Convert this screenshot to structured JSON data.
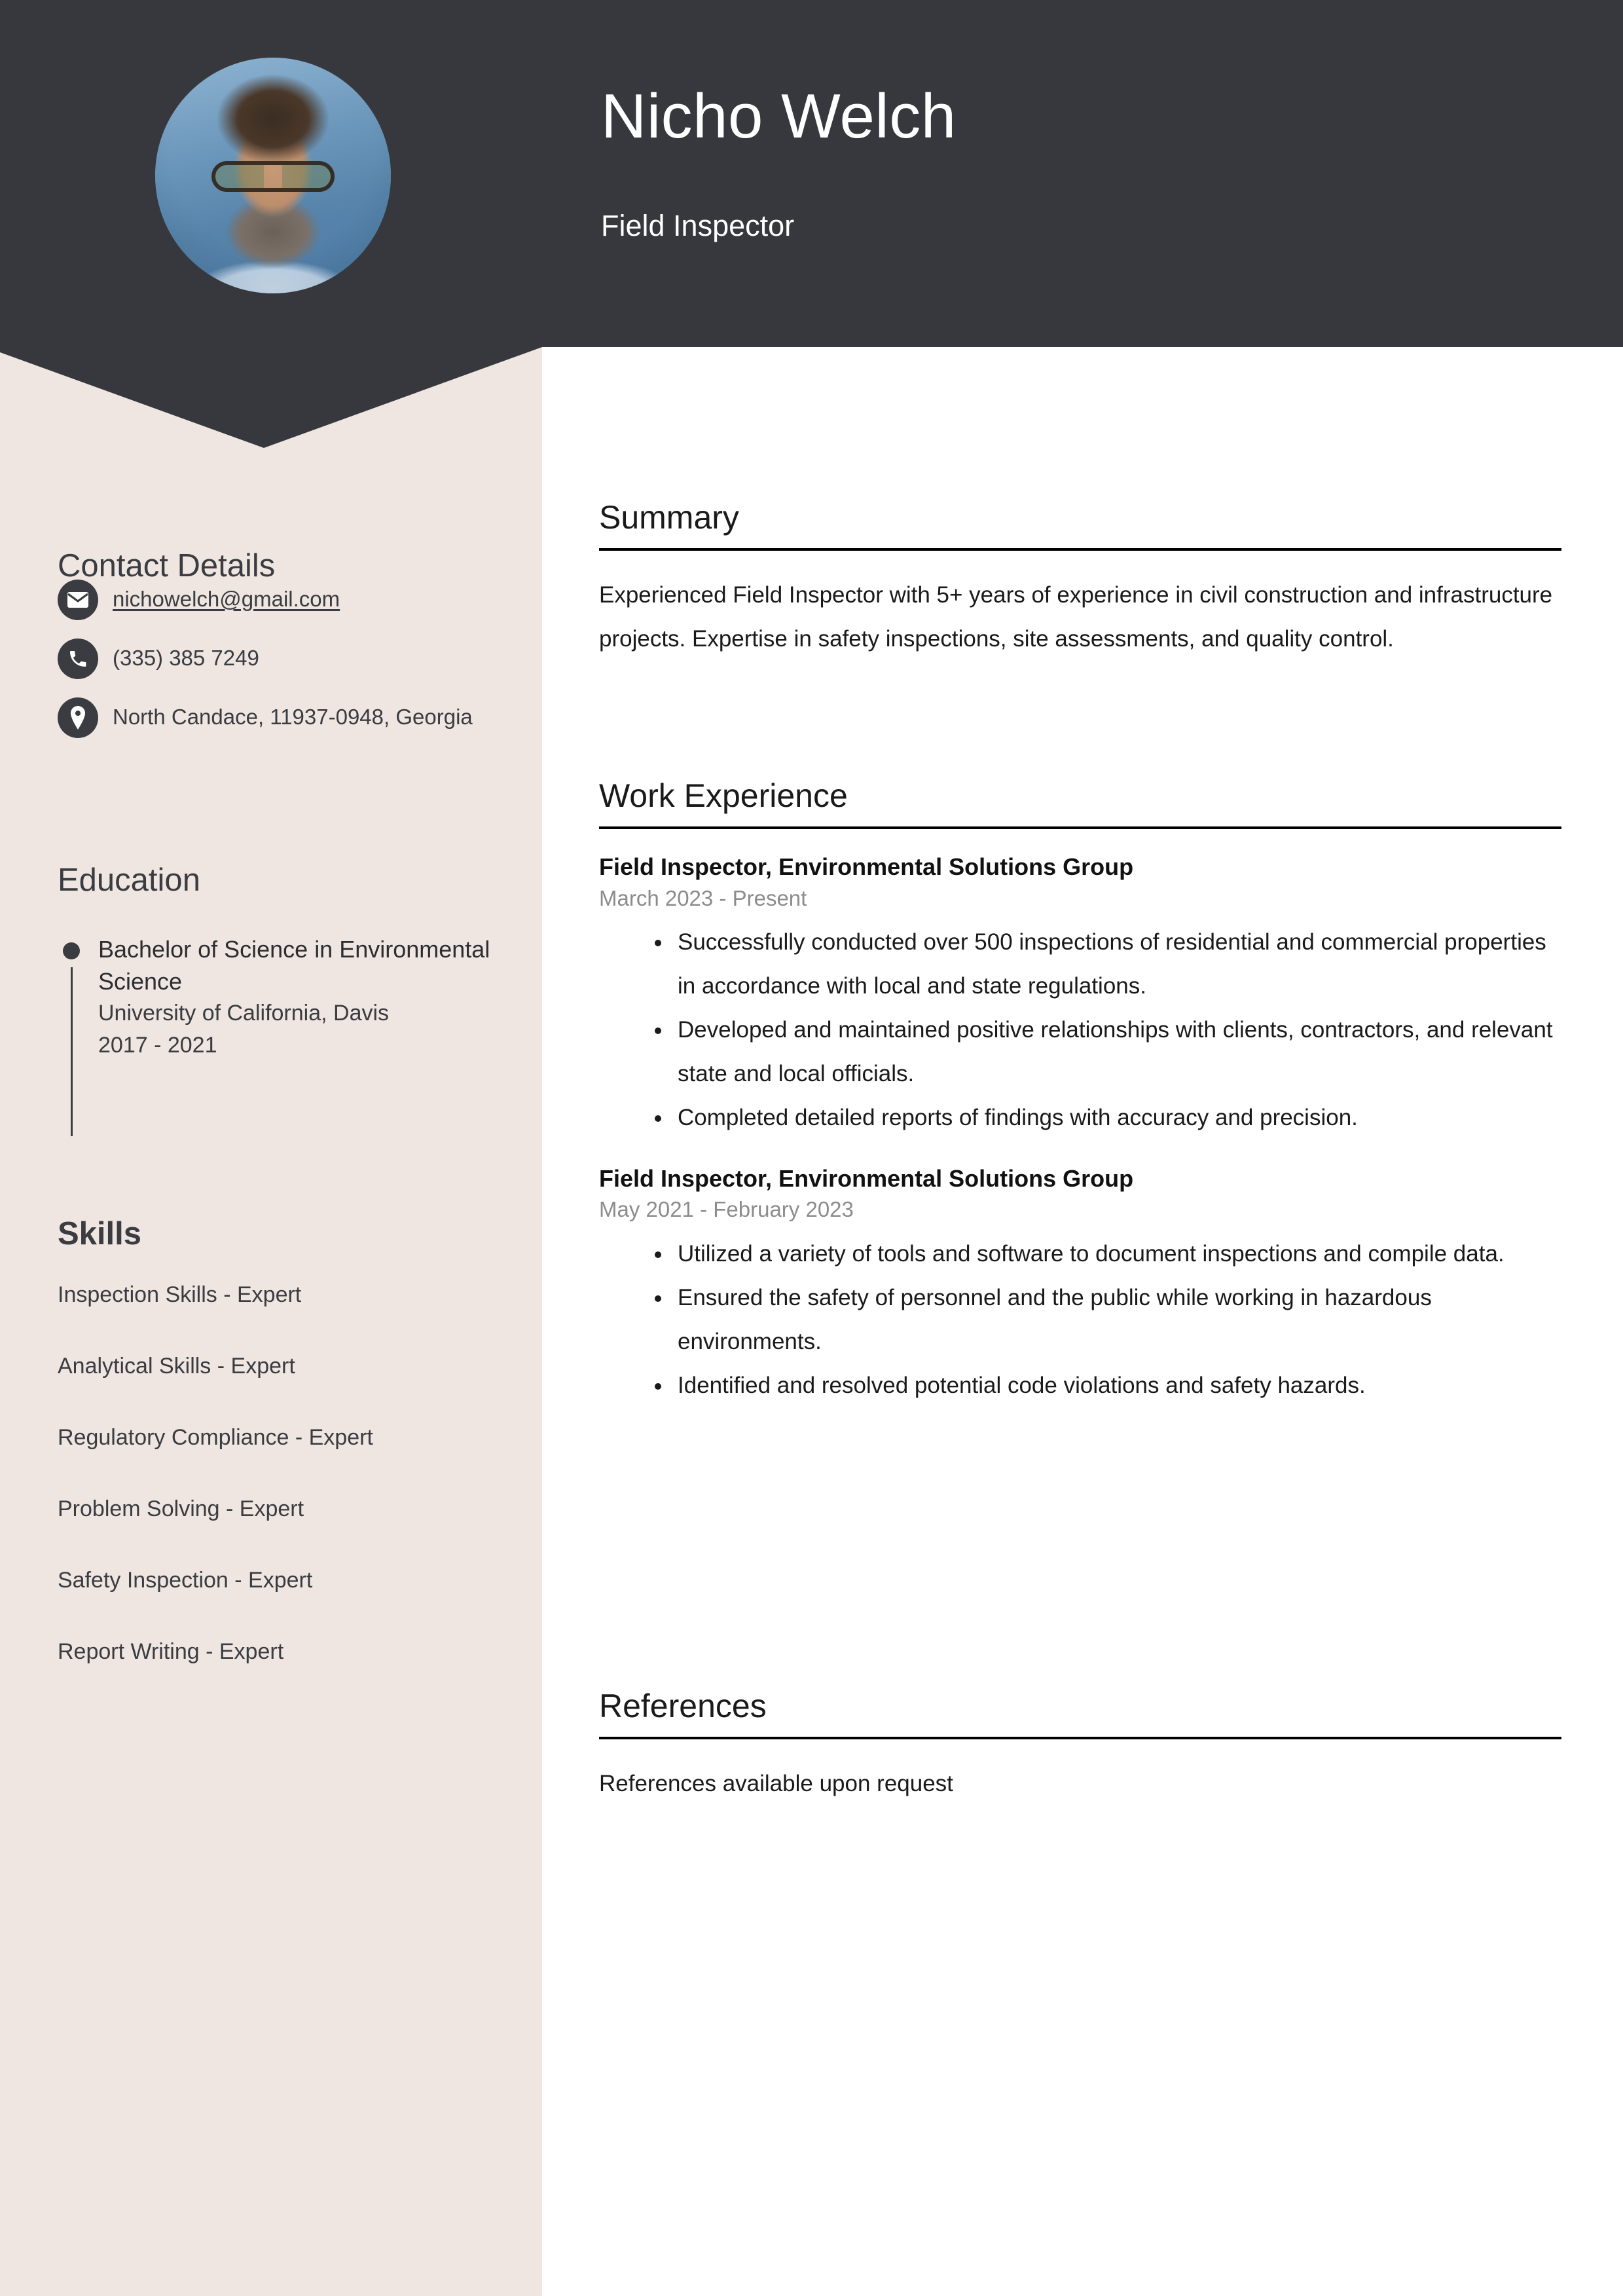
{
  "header": {
    "name": "Nicho Welch",
    "job_title": "Field Inspector",
    "background_color": "#36383D",
    "avatar_alt": "portrait-photo"
  },
  "sidebar": {
    "background_color": "#EFE6E1",
    "contact": {
      "heading": "Contact Details",
      "items": [
        {
          "icon": "envelope-icon",
          "value": "nichowelch@gmail.com",
          "type": "email"
        },
        {
          "icon": "phone-icon",
          "value": "(335) 385 7249",
          "type": "phone"
        },
        {
          "icon": "location-pin-icon",
          "value": "North Candace, 11937-0948, Georgia",
          "type": "address"
        }
      ]
    },
    "education": {
      "heading": "Education",
      "items": [
        {
          "degree": "Bachelor of Science in Environmental Science",
          "school": "University of California, Davis",
          "dates": "2017 - 2021"
        }
      ]
    },
    "skills": {
      "heading": "Skills",
      "items": [
        "Inspection Skills - Expert",
        "Analytical Skills - Expert",
        "Regulatory Compliance - Expert",
        "Problem Solving - Expert",
        "Safety Inspection - Expert",
        "Report Writing - Expert"
      ]
    }
  },
  "main": {
    "summary": {
      "heading": "Summary",
      "text": "Experienced Field Inspector with 5+ years of experience in civil construction and infrastructure projects. Expertise in safety inspections, site assessments, and quality control."
    },
    "work_experience": {
      "heading": "Work Experience",
      "entries": [
        {
          "role": "Field Inspector, Environmental Solutions Group",
          "dates": "March 2023 - Present",
          "bullets": [
            "Successfully conducted over 500 inspections of residential and commercial properties in accordance with local and state regulations.",
            "Developed and maintained positive relationships with clients, contractors, and relevant state and local officials.",
            "Completed detailed reports of findings with accuracy and precision."
          ]
        },
        {
          "role": "Field Inspector, Environmental Solutions Group",
          "dates": "May 2021 - February 2023",
          "bullets": [
            "Utilized a variety of tools and software to document inspections and compile data.",
            "Ensured the safety of personnel and the public while working in hazardous environments.",
            "Identified and resolved potential code violations and safety hazards."
          ]
        }
      ]
    },
    "references": {
      "heading": "References",
      "text": "References available upon request"
    }
  }
}
